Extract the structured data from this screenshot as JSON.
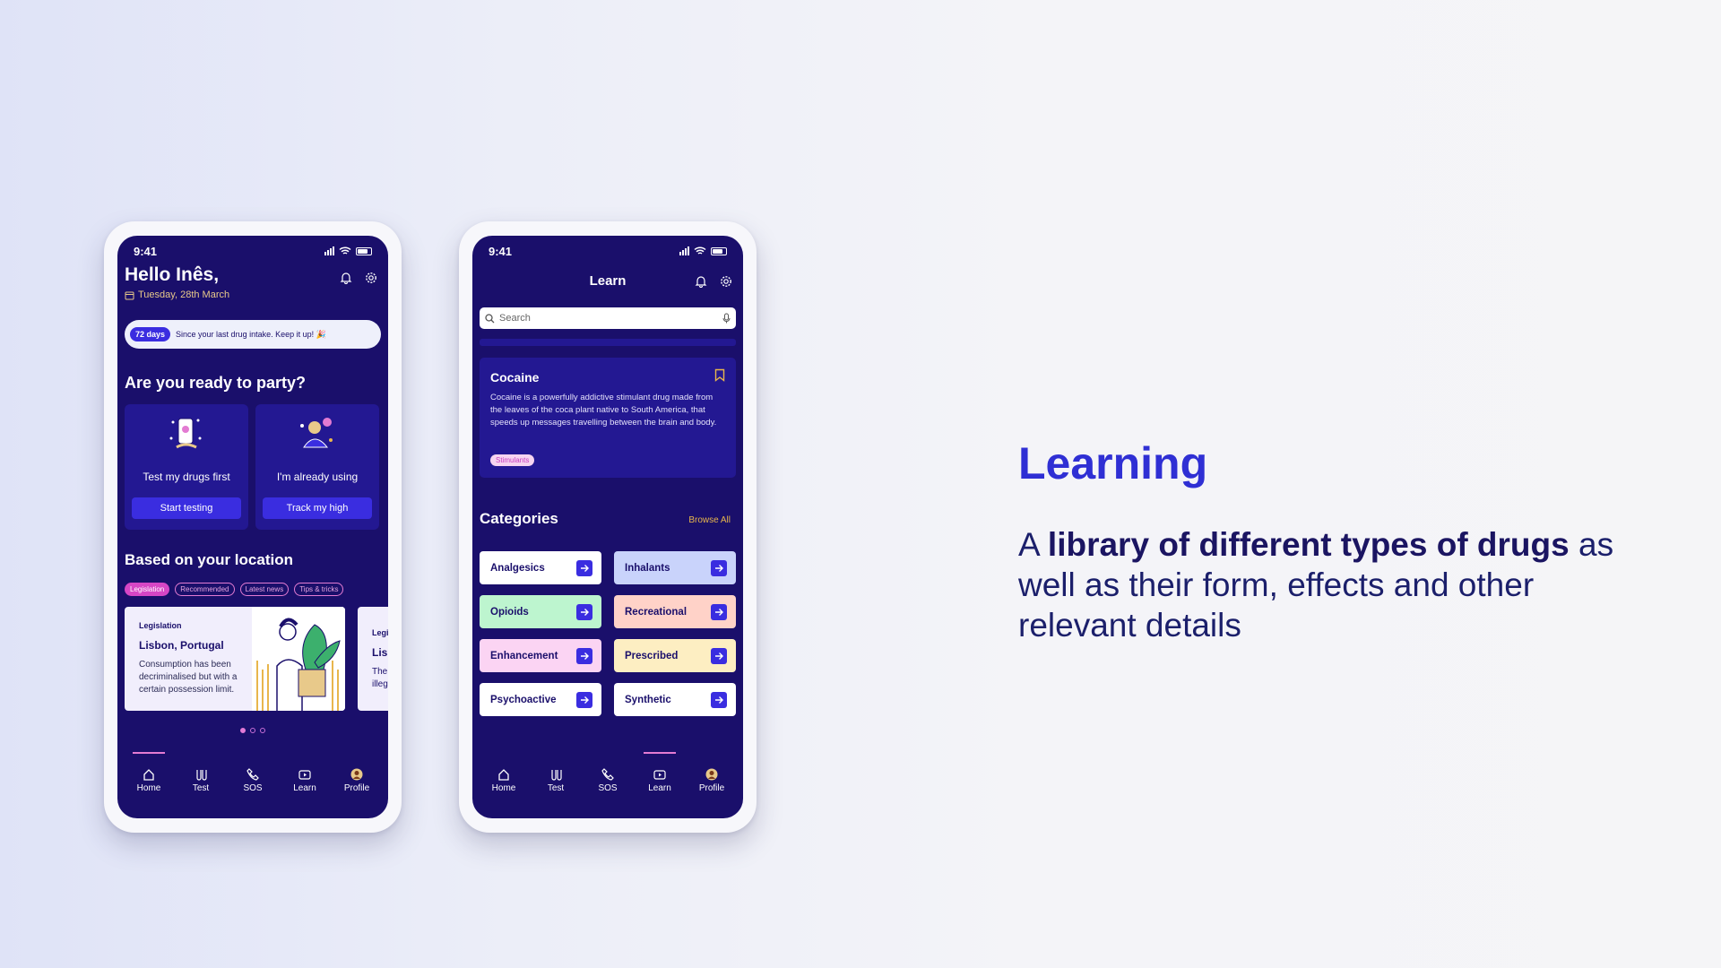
{
  "colors": {
    "accent": "#3a2de0",
    "screen_bg": "#1a0f6b",
    "heading": "#2f2fd4",
    "pink": "#e37bd2",
    "gold": "#e8b64c"
  },
  "phone1": {
    "time": "9:41",
    "greeting": "Hello Inês,",
    "date": "Tuesday, 28th March",
    "streak": {
      "days": "72 days",
      "text": "Since your last drug intake. Keep it up! 🎉"
    },
    "section1_title": "Are you ready to party?",
    "cards": [
      {
        "label": "Test my drugs first",
        "button": "Start testing",
        "icon": "phone-test-illustration"
      },
      {
        "label": "I'm already using",
        "button": "Track my high",
        "icon": "party-person-illustration"
      }
    ],
    "section2_title": "Based on your location",
    "chips": [
      "Legislation",
      "Recommended",
      "Latest news",
      "Tips & tricks"
    ],
    "location_cards": [
      {
        "tag": "Legislation",
        "city": "Lisbon, Portugal",
        "desc": "Consumption has been decriminalised but with a certain possession limit."
      },
      {
        "tag": "Legi",
        "city": "Lisb",
        "desc": "The\nilleg"
      }
    ]
  },
  "phone2": {
    "time": "9:41",
    "title": "Learn",
    "search_placeholder": "Search",
    "featured": {
      "title": "Cocaine",
      "desc": "Cocaine is a powerfully addictive stimulant drug made from the leaves of the coca plant native to South America, that speeds up messages travelling between the brain and body.",
      "tag": "Stimulants"
    },
    "categories_title": "Categories",
    "browse_all": "Browse All",
    "categories": [
      {
        "label": "Analgesics",
        "color": "#ffffff"
      },
      {
        "label": "Inhalants",
        "color": "#c9d3fb"
      },
      {
        "label": "Opioids",
        "color": "#bdf5cf"
      },
      {
        "label": "Recreational",
        "color": "#ffd2c8"
      },
      {
        "label": "Enhancement",
        "color": "#fbd4f3"
      },
      {
        "label": "Prescribed",
        "color": "#fdeec2"
      },
      {
        "label": "Psychoactive",
        "color": "#ffffff"
      },
      {
        "label": "Synthetic",
        "color": "#ffffff"
      }
    ]
  },
  "nav": {
    "items": [
      "Home",
      "Test",
      "SOS",
      "Learn",
      "Profile"
    ]
  },
  "right": {
    "heading": "Learning",
    "para_prefix": "A ",
    "para_bold": "library of different types of drugs",
    "para_rest": " as well as their form, effects and other relevant details"
  }
}
